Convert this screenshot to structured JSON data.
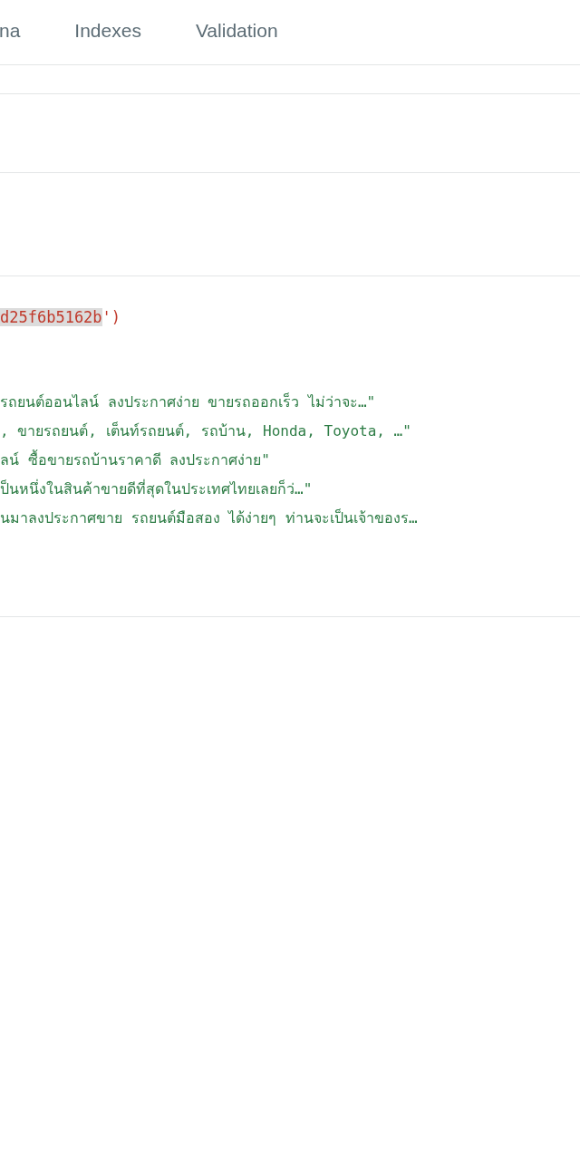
{
  "tabs": [
    {
      "label": "na",
      "selected": false
    },
    {
      "label": "Indexes",
      "selected": false
    },
    {
      "label": "Validation",
      "selected": false
    }
  ],
  "document": {
    "id_line": {
      "highlighted": "d25f6b5162b",
      "rest": "')"
    },
    "values": [
      "รถยนต์ออนไลน์ ลงประกาศง่าย ขายรถออกเร็ว ไม่ว่าจะ…\"",
      ", ขายรถยนต์, เต็นท์รถยนต์, รถบ้าน, Honda, Toyota, …\"",
      "ลน์ ซื้อขายรถบ้านราคาดี ลงประกาศง่าย\"",
      "ป็นหนึ่งในสินค้าขายดีที่สุดในประเทศไทยเลยก็ว่…\"",
      "นมาลงประกาศขาย รถยนต์มือสอง ได้ง่ายๆ ท่านจะเป็นเจ้าของร…"
    ]
  }
}
